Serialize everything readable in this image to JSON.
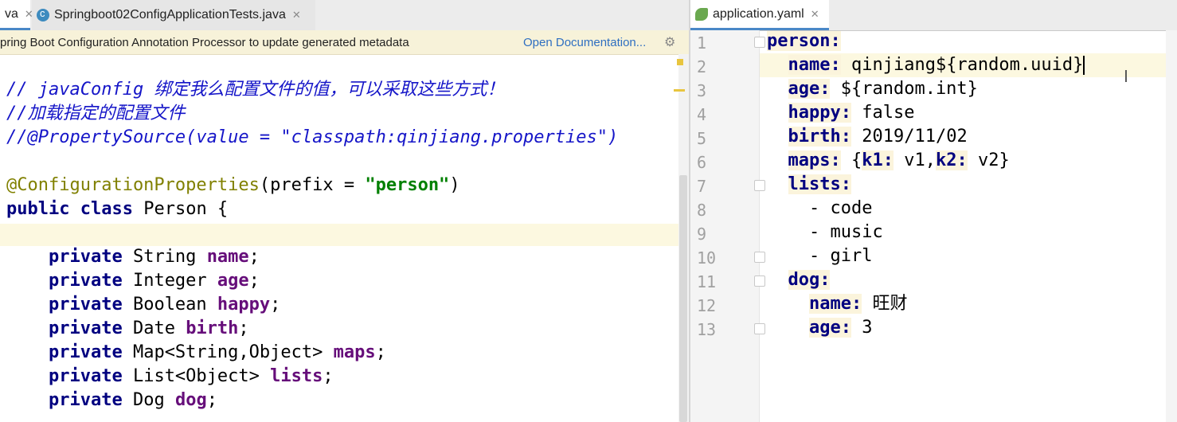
{
  "left_tabs": [
    {
      "label": "va",
      "active": true
    },
    {
      "label": "Springboot02ConfigApplicationTests.java",
      "active": false
    }
  ],
  "right_tabs": [
    {
      "label": "application.yaml",
      "active": true
    }
  ],
  "notice": {
    "message": "pring Boot Configuration Annotation Processor to update generated metadata",
    "link": "Open Documentation...",
    "icon": "gear-icon"
  },
  "left_code": {
    "comment1": "// javaConfig 绑定我么配置文件的值，可以采取这些方式！",
    "comment2": "//加载指定的配置文件",
    "comment3": "//@PropertySource(value = \"classpath:qinjiang.properties\")",
    "annotation": "@ConfigurationProperties",
    "annotation_prefix": "(prefix = ",
    "annotation_value": "\"person\"",
    "annotation_close": ")",
    "kw_public": "public",
    "kw_class": "class",
    "class_name": "Person {",
    "kw_private": "private",
    "fields": [
      {
        "type": "String",
        "name": "name"
      },
      {
        "type": "Integer",
        "name": "age"
      },
      {
        "type": "Boolean",
        "name": "happy"
      },
      {
        "type": "Date",
        "name": "birth"
      },
      {
        "type": "Map<String,Object>",
        "name": "maps"
      },
      {
        "type": "List<Object>",
        "name": "lists"
      },
      {
        "type": "Dog",
        "name": "dog"
      }
    ]
  },
  "yaml": {
    "line_numbers": [
      "1",
      "2",
      "3",
      "4",
      "5",
      "6",
      "7",
      "8",
      "9",
      "10",
      "11",
      "12",
      "13"
    ],
    "person_key": "person:",
    "name_key": "name:",
    "name_value": "qinjiang${random.uuid}",
    "age_key": "age:",
    "age_value": "${random.int}",
    "happy_key": "happy:",
    "happy_value": "false",
    "birth_key": "birth:",
    "birth_value": "2019/11/02",
    "maps_key": "maps:",
    "maps_open": "{",
    "k1_key": "k1:",
    "k1_value": "v1,",
    "k2_key": "k2:",
    "k2_value": "v2}",
    "lists_key": "lists:",
    "list_items": [
      "- code",
      "- music",
      "- girl"
    ],
    "dog_key": "dog:",
    "dog_name_key": "name:",
    "dog_name_value": "旺财",
    "dog_age_key": "age:",
    "dog_age_value": "3"
  }
}
